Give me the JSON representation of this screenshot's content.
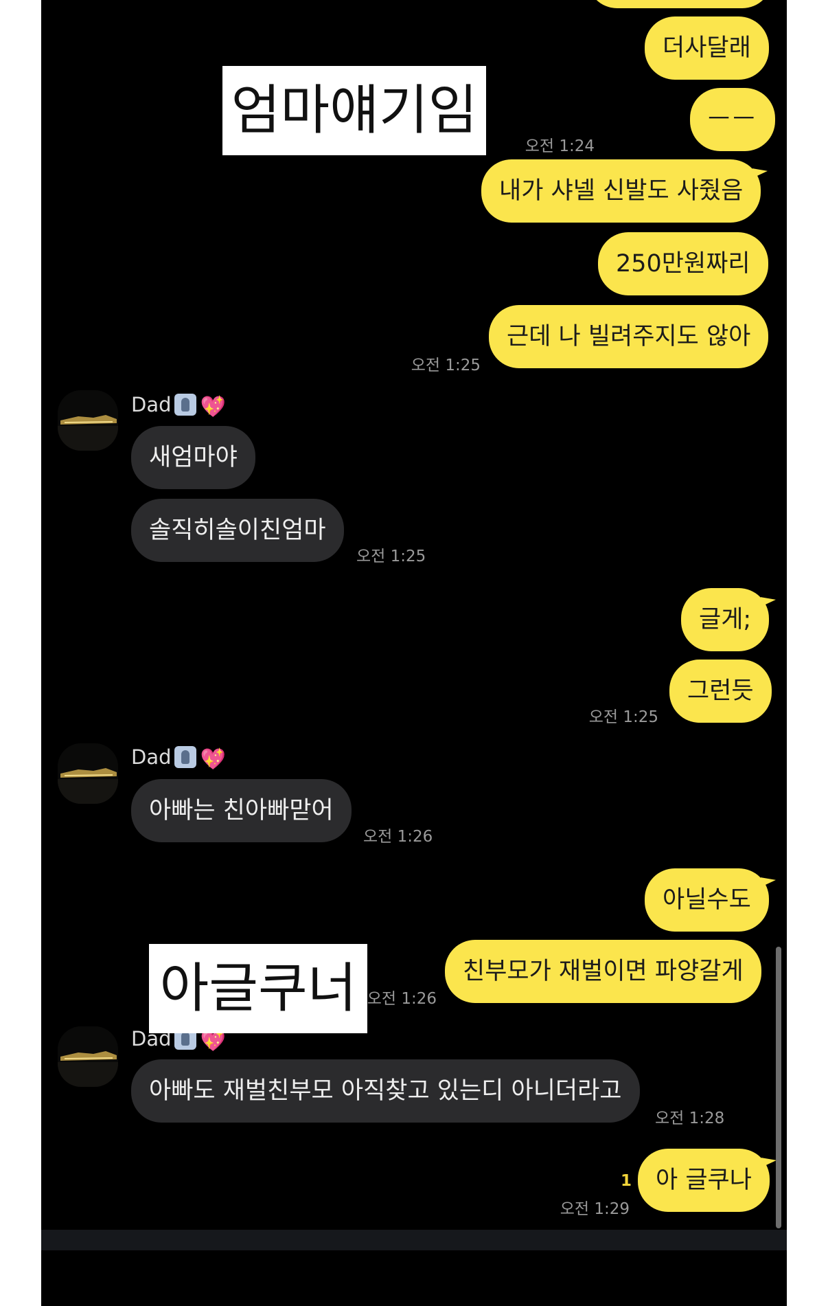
{
  "overlay_captions": [
    "엄마얘기임",
    "아글쿠너"
  ],
  "contact": {
    "name": "Dad",
    "badge_icon": "person-in-frame-emoji",
    "heart_icon": "sparkling-heart-emoji"
  },
  "messages": [
    {
      "side": "out",
      "text": "더사달래"
    },
    {
      "side": "out",
      "text": "ㅡㅡ",
      "time": "오전 1:24"
    },
    {
      "side": "out",
      "text": "내가 샤넬 신발도 사줬음"
    },
    {
      "side": "out",
      "text": "250만원짜리"
    },
    {
      "side": "out",
      "text": "근데 나 빌려주지도 않아",
      "time": "오전 1:25"
    },
    {
      "side": "in",
      "text": "새엄마야"
    },
    {
      "side": "in",
      "text": "솔직히솔이친엄마",
      "time": "오전 1:25"
    },
    {
      "side": "out",
      "text": "글게;"
    },
    {
      "side": "out",
      "text": "그런듯",
      "time": "오전 1:25"
    },
    {
      "side": "in",
      "text": "아빠는 친아빠맏어",
      "time": "오전 1:26"
    },
    {
      "side": "out",
      "text": "아닐수도"
    },
    {
      "side": "out",
      "text": "친부모가 재벌이면 파양갈게",
      "time": "오전 1:26"
    },
    {
      "side": "in",
      "text": "아빠도 재벌친부모 아직찾고 있는디 아니더라고",
      "time": "오전 1:28"
    },
    {
      "side": "out",
      "text": "아 글쿠나",
      "time": "오전 1:29",
      "unread": "1"
    }
  ],
  "colors": {
    "outgoing_bubble": "#fbe54d",
    "incoming_bubble": "#2b2b2d",
    "background": "#000000"
  }
}
